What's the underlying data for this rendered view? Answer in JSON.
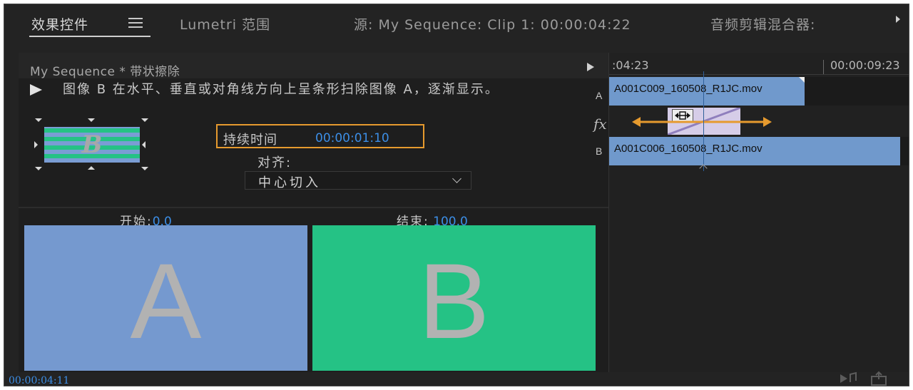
{
  "tabs": [
    {
      "label": "效果控件"
    },
    {
      "label": "Lumetri 范围"
    },
    {
      "label": "源: My Sequence: Clip 1: 00:00:04:22"
    },
    {
      "label": "音频剪辑混合器:"
    }
  ],
  "effect_panel": {
    "sequence_title": "My Sequence * 带状擦除",
    "description": "图像 B 在水平、垂直或对角线方向上呈条形扫除图像 A，逐渐显示。",
    "thumbnail_letter": "B",
    "duration_label": "持续时间",
    "duration_value": "00:00:01:10",
    "align_label": "对齐:",
    "align_value": "中心切入",
    "start_label": "开始:",
    "start_value": "0.0",
    "end_label": "结束:",
    "end_value": "100.0",
    "preview_a_letter": "A",
    "preview_b_letter": "B",
    "track_a_label": "A",
    "track_b_label": "B",
    "fx_label": "fx"
  },
  "timeline": {
    "ruler_start": ":04:23",
    "ruler_end": "00:00:09:23",
    "clip_a": "A001C009_160508_R1JC.mov",
    "clip_b": "A001C006_160508_R1JC.mov"
  },
  "status": {
    "current_time": "00:00:04:11"
  },
  "colors": {
    "accent_blue": "#3c8ee6",
    "highlight_orange": "#e69a2e",
    "preview_a": "#7599cf",
    "preview_b": "#25c285"
  }
}
